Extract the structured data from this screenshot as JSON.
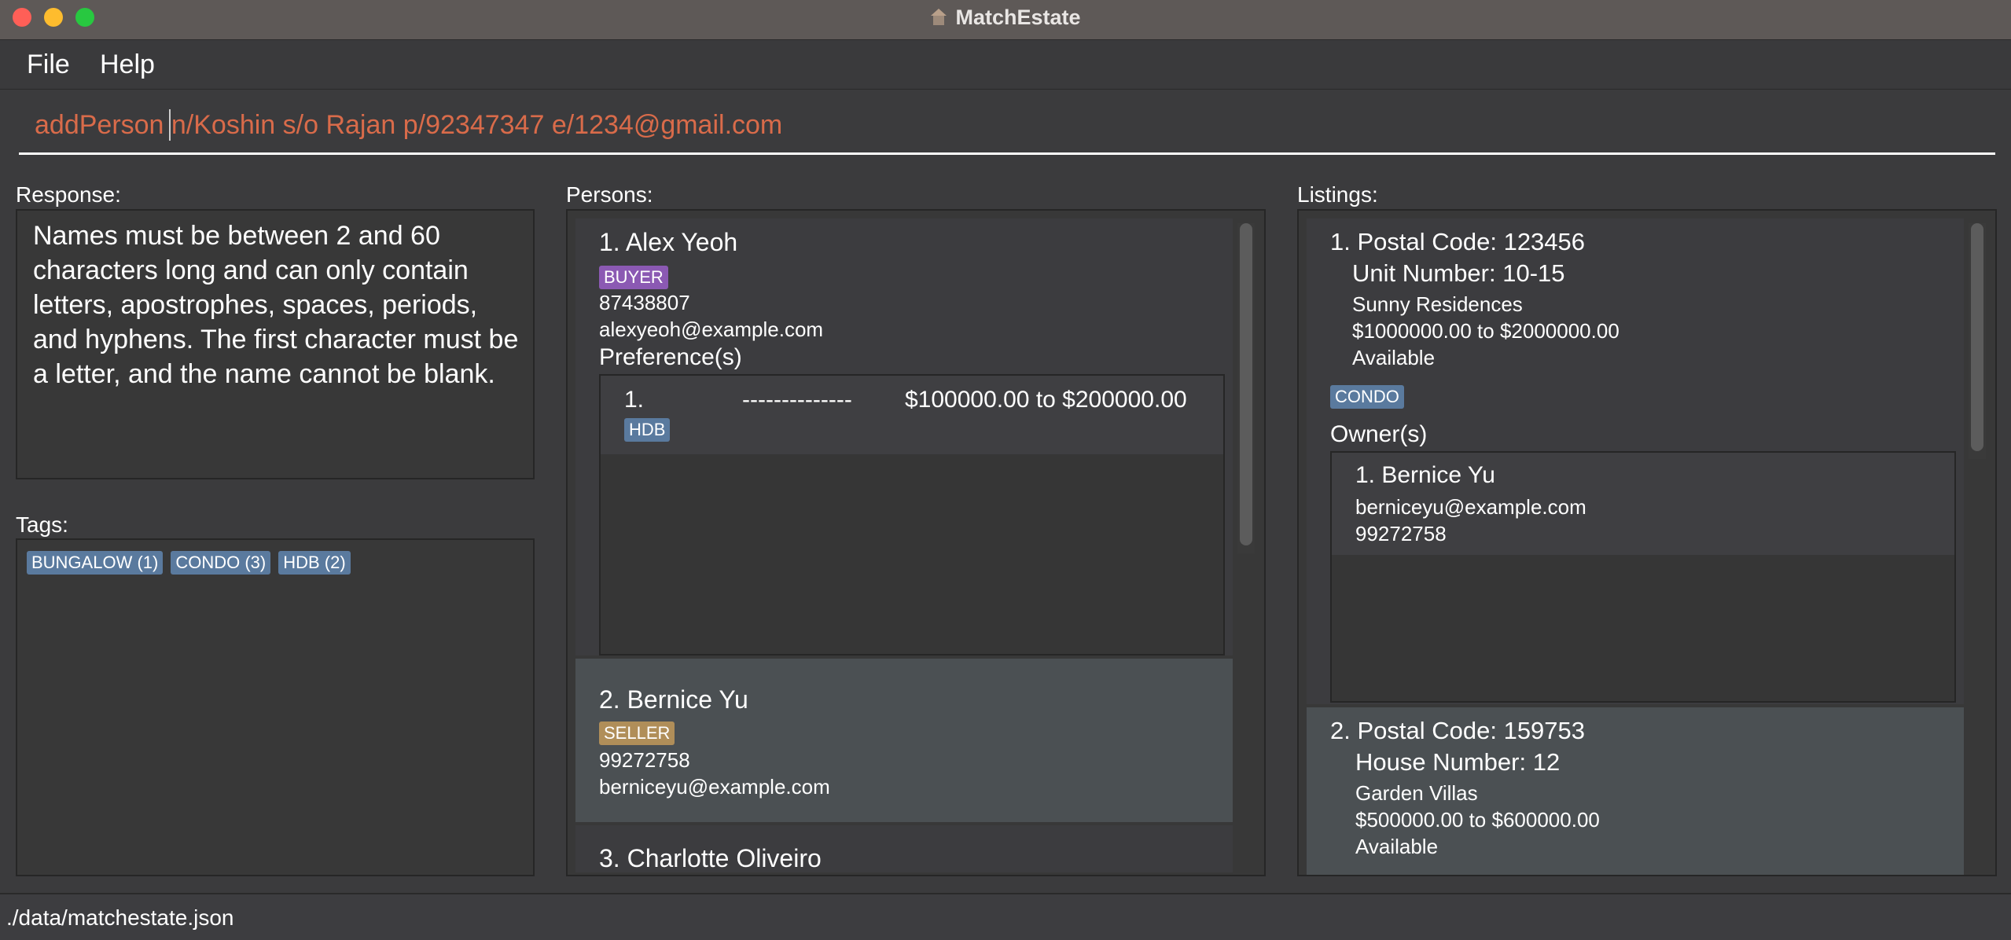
{
  "window": {
    "title": "MatchEstate"
  },
  "menu": {
    "file": "File",
    "help": "Help"
  },
  "command": {
    "value": "addPerson n/Koshin s/o Rajan p/92347347 e/1234@gmail.com"
  },
  "response": {
    "label": "Response:",
    "text": "Names must be between 2 and 60 characters long and can only contain letters, apostrophes, spaces, periods, and hyphens. The first character must be a letter, and the name cannot be blank."
  },
  "tags": {
    "label": "Tags:",
    "items": [
      "BUNGALOW (1)",
      "CONDO (3)",
      "HDB (2)"
    ]
  },
  "persons": {
    "label": "Persons:",
    "items": [
      {
        "name": "1. Alex Yeoh",
        "role": "BUYER",
        "phone": "87438807",
        "email": "alexyeoh@example.com",
        "preferences_label": "Preference(s)",
        "preferences": [
          {
            "index": "1.",
            "dashes": "--------------",
            "range": "$100000.00 to $200000.00",
            "tag": "HDB"
          }
        ]
      },
      {
        "name": "2. Bernice Yu",
        "role": "SELLER",
        "phone": "99272758",
        "email": "berniceyu@example.com"
      },
      {
        "name": "3. Charlotte Oliveiro"
      }
    ]
  },
  "listings": {
    "label": "Listings:",
    "items": [
      {
        "postal": "1. Postal Code: 123456",
        "unit": "Unit Number: 10-15",
        "name": "Sunny Residences",
        "price": "$1000000.00 to $2000000.00",
        "availability": "Available",
        "tag": "CONDO",
        "owners_label": "Owner(s)",
        "owners": [
          {
            "name": "1. Bernice Yu",
            "email": "berniceyu@example.com",
            "phone": "99272758"
          }
        ]
      },
      {
        "postal": "2. Postal Code: 159753",
        "unit": "House Number: 12",
        "name": "Garden Villas",
        "price": "$500000.00 to $600000.00",
        "availability": "Available"
      }
    ]
  },
  "status": {
    "path": "./data/matchestate.json"
  },
  "colors": {
    "tag_default": "#5a7a9e",
    "buyer": "#8b59b3",
    "seller": "#b08e59",
    "command_text": "#d96b4a"
  }
}
